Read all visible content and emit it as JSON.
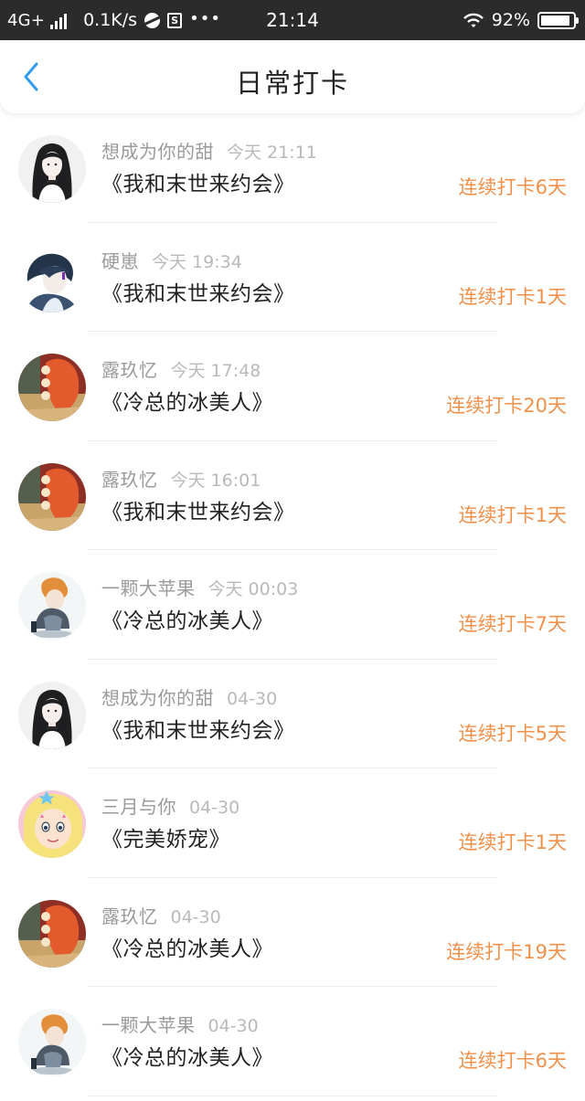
{
  "status_bar": {
    "network": "4G+",
    "speed": "0.1K/s",
    "time": "21:14",
    "battery": "92%",
    "battery_level": 0.92,
    "icons": [
      "signal-icon",
      "ball-icon",
      "s-icon",
      "more-dots-icon",
      "wifi-icon",
      "battery-icon"
    ]
  },
  "header": {
    "title": "日常打卡",
    "back_icon": "chevron-left-icon",
    "accent_color": "#2f9bf0"
  },
  "colors": {
    "streak": "#f0914b",
    "name": "#9a9a9a",
    "time": "#b9b9b9",
    "book": "#222222"
  },
  "items": [
    {
      "name": "想成为你的甜",
      "time": "今天 21:11",
      "book": "《我和末世来约会》",
      "streak": "连续打卡6天",
      "avatar": "avatar-dark-hair"
    },
    {
      "name": "硬崽",
      "time": "今天 19:34",
      "book": "《我和末世来约会》",
      "streak": "连续打卡1天",
      "avatar": "avatar-blue-hair"
    },
    {
      "name": "露玖忆",
      "time": "今天 17:48",
      "book": "《冷总的冰美人》",
      "streak": "连续打卡20天",
      "avatar": "avatar-red-hair"
    },
    {
      "name": "露玖忆",
      "time": "今天 16:01",
      "book": "《我和末世来约会》",
      "streak": "连续打卡1天",
      "avatar": "avatar-red-hair"
    },
    {
      "name": "一颗大苹果",
      "time": "今天 00:03",
      "book": "《冷总的冰美人》",
      "streak": "连续打卡7天",
      "avatar": "avatar-orange-hair"
    },
    {
      "name": "想成为你的甜",
      "time": "04-30",
      "book": "《我和末世来约会》",
      "streak": "连续打卡5天",
      "avatar": "avatar-dark-hair"
    },
    {
      "name": "三月与你",
      "time": "04-30",
      "book": "《完美娇宠》",
      "streak": "连续打卡1天",
      "avatar": "avatar-cartoon-star"
    },
    {
      "name": "露玖忆",
      "time": "04-30",
      "book": "《冷总的冰美人》",
      "streak": "连续打卡19天",
      "avatar": "avatar-red-hair"
    },
    {
      "name": "一颗大苹果",
      "time": "04-30",
      "book": "《冷总的冰美人》",
      "streak": "连续打卡6天",
      "avatar": "avatar-orange-hair"
    }
  ]
}
